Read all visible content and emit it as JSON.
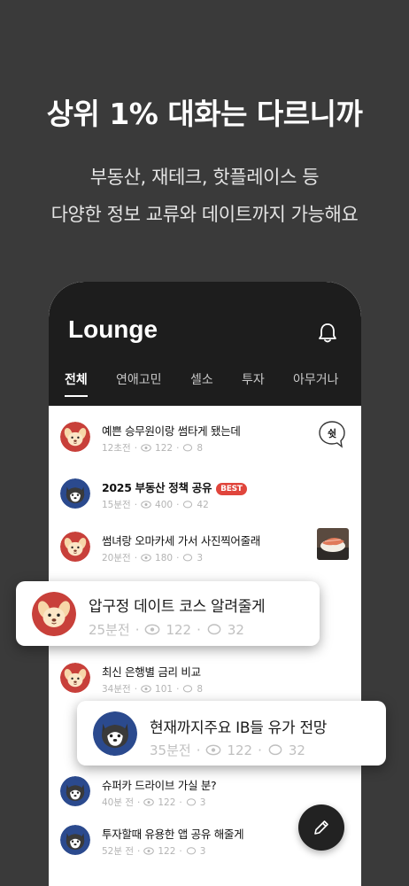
{
  "promo": {
    "headline": "상위 1% 대화는 다르니까",
    "sub_line1": "부동산, 재테크, 핫플레이스 등",
    "sub_line2": "다양한 정보 교류와 데이트까지 가능해요"
  },
  "app": {
    "title": "Lounge",
    "tabs": [
      "전체",
      "연애고민",
      "셀소",
      "투자",
      "아무거나"
    ],
    "active_tab": 0
  },
  "posts": [
    {
      "title": "예쁜 승무원이랑 썸타게 됐는데",
      "time": "12초전",
      "views": "122",
      "comments": "8",
      "avatar": "dog",
      "badge": "",
      "extra": "bubble",
      "bubble_text": "쉿"
    },
    {
      "title": "2025 부동산 정책 공유",
      "time": "15분전",
      "views": "400",
      "comments": "42",
      "avatar": "husky",
      "badge": "BEST"
    },
    {
      "title": "썸녀랑 오마카세 가서 사진찍어줄래",
      "time": "20분전",
      "views": "180",
      "comments": "3",
      "avatar": "dog",
      "extra": "thumb"
    },
    {
      "title": "최신 은행별 금리 비교",
      "time": "34분전",
      "views": "101",
      "comments": "8",
      "avatar": "dog"
    },
    {
      "title": "슈퍼카 드라이브 가실 분?",
      "time": "40분 전",
      "views": "122",
      "comments": "3",
      "avatar": "husky"
    },
    {
      "title": "투자할때 유용한 앱 공유 해줄게",
      "time": "52분 전",
      "views": "122",
      "comments": "3",
      "avatar": "husky"
    }
  ],
  "cards": [
    {
      "title": "압구정 데이트 코스 알려줄게",
      "time": "25분전",
      "views": "122",
      "comments": "32",
      "avatar": "dog"
    },
    {
      "title": "현재까지주요 IB들 유가 전망",
      "time": "35분전",
      "views": "122",
      "comments": "32",
      "avatar": "husky"
    }
  ],
  "icons": {
    "bell": "bell-icon",
    "eye": "eye-icon",
    "comment": "comment-icon",
    "write": "pencil-icon"
  },
  "colors": {
    "background": "#3a3a3a",
    "header": "#1d1d1d",
    "best_badge": "#e0453c",
    "dog_avatar_bg": "#c8403a",
    "husky_avatar_bg": "#2b4a8e"
  }
}
